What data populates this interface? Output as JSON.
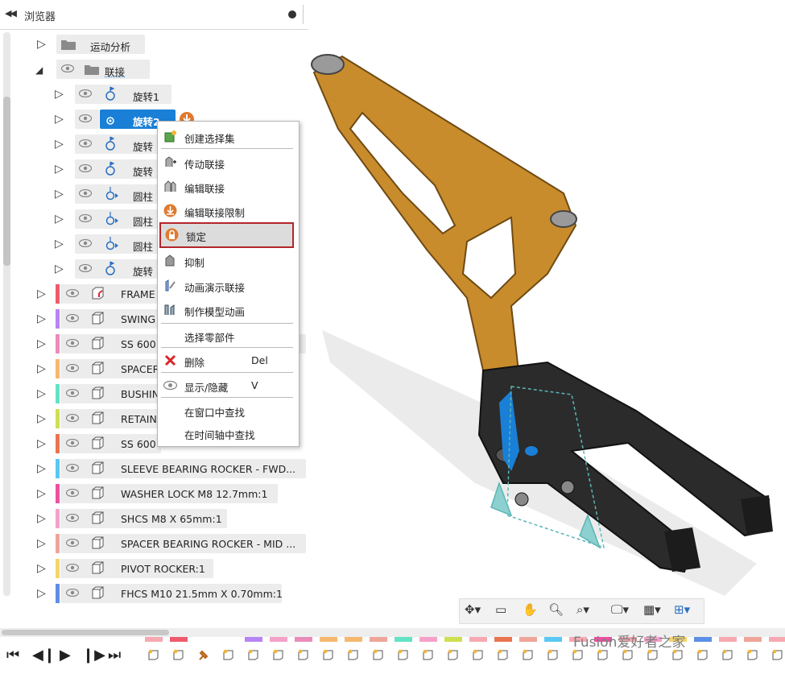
{
  "browser": {
    "title": "浏览器"
  },
  "tree": {
    "folders": [
      {
        "label": "运动分析"
      },
      {
        "label": "联接"
      }
    ],
    "joints": [
      {
        "label": "旋转1"
      },
      {
        "label": "旋转2"
      },
      {
        "label": "旋转"
      },
      {
        "label": "旋转"
      },
      {
        "label": "圆柱"
      },
      {
        "label": "圆柱"
      },
      {
        "label": "圆柱"
      },
      {
        "label": "旋转"
      }
    ],
    "components": [
      {
        "label": "FRAME",
        "color": "#ef5b6d"
      },
      {
        "label": "SWING",
        "color": "#b784f5"
      },
      {
        "label": "SS 600",
        "color": "#e98cb9"
      },
      {
        "label": "SPACER",
        "color": "#f6b86f"
      },
      {
        "label": "BUSHIN",
        "color": "#63e2c6"
      },
      {
        "label": "RETAIN",
        "color": "#cfdf51"
      },
      {
        "label": "SS 600",
        "color": "#ea7450"
      },
      {
        "label": "SLEEVE BEARING ROCKER - FWD...",
        "color": "#59c8f4"
      },
      {
        "label": "WASHER LOCK M8 12.7mm:1",
        "color": "#ee4fa0"
      },
      {
        "label": "SHCS M8 X 65mm:1",
        "color": "#f5a1c9"
      },
      {
        "label": "SPACER BEARING ROCKER - MID ...",
        "color": "#efa59a"
      },
      {
        "label": "PIVOT ROCKER:1",
        "color": "#f3d56b"
      },
      {
        "label": "FHCS M10 21.5mm X 0.70mm:1",
        "color": "#5d8fe6"
      }
    ]
  },
  "context_menu": {
    "items": [
      {
        "label": "创建选择集",
        "shortcut": "",
        "icon": "create-selection-set-icon"
      },
      {
        "label": "传动联接",
        "shortcut": "",
        "icon": "motion-link-icon"
      },
      {
        "label": "编辑联接",
        "shortcut": "",
        "icon": "edit-joint-icon"
      },
      {
        "label": "编辑联接限制",
        "shortcut": "",
        "icon": "edit-joint-limits-icon"
      },
      {
        "label": "锁定",
        "shortcut": "",
        "icon": "lock-icon"
      },
      {
        "label": "抑制",
        "shortcut": "",
        "icon": "suppress-icon"
      },
      {
        "label": "动画演示联接",
        "shortcut": "",
        "icon": "animate-joint-icon"
      },
      {
        "label": "制作模型动画",
        "shortcut": "",
        "icon": "animate-model-icon"
      },
      {
        "label": "选择零部件",
        "shortcut": "",
        "icon": ""
      },
      {
        "label": "删除",
        "shortcut": "Del",
        "icon": "delete-icon"
      },
      {
        "label": "显示/隐藏",
        "shortcut": "V",
        "icon": "eye-icon"
      },
      {
        "label": "在窗口中查找",
        "shortcut": "",
        "icon": ""
      },
      {
        "label": "在时间轴中查找",
        "shortcut": "",
        "icon": ""
      }
    ]
  },
  "watermark": "Fusion爱好者之家",
  "colors": {
    "selection": "#1a7fd6",
    "frame_orange": "#c78a2a",
    "lock_highlight": "#b3262b"
  }
}
